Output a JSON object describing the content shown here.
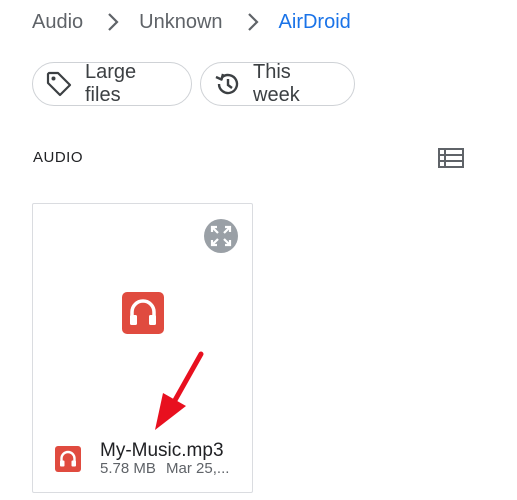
{
  "breadcrumb": {
    "items": [
      "Audio",
      "Unknown",
      "AirDroid"
    ]
  },
  "filters": {
    "large_files": "Large files",
    "this_week": "This week"
  },
  "section": {
    "title": "AUDIO"
  },
  "file": {
    "name": "My-Music.mp3",
    "size": "5.78 MB",
    "date": "Mar 25,..."
  },
  "icons": {
    "chevron": "chevron-right-icon",
    "tag": "tag-icon",
    "history": "history-icon",
    "list_view": "list-view-icon",
    "expand": "fullscreen-icon",
    "audio": "headphones-icon",
    "arrow": "annotation-arrow"
  },
  "colors": {
    "accent": "#1a73e8",
    "audio_red": "#e04b3f",
    "annotation_red": "#e8101f"
  }
}
